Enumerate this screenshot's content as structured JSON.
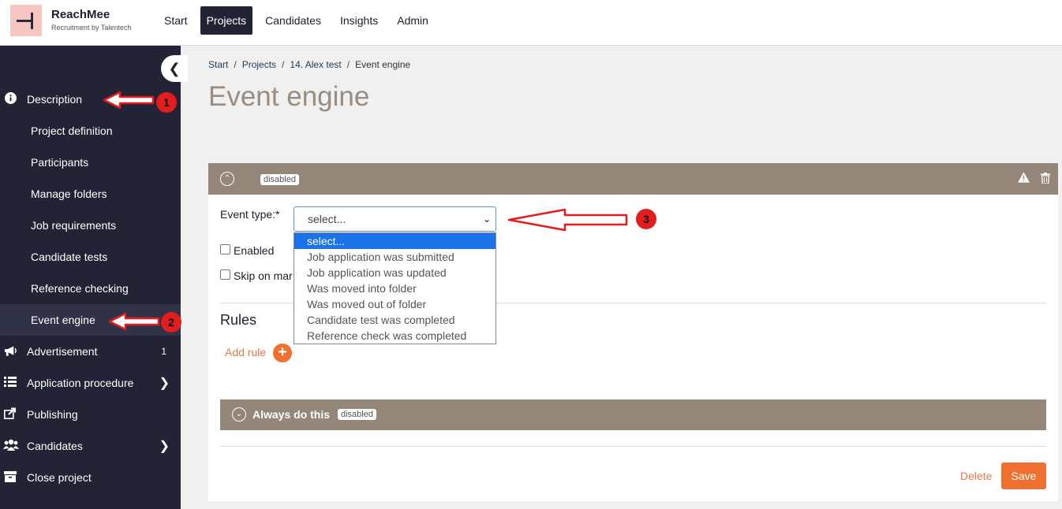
{
  "app": {
    "brand": "ReachMee",
    "tagline": "Recruitment by Talentech"
  },
  "topnav": [
    {
      "label": "Start"
    },
    {
      "label": "Projects",
      "active": true
    },
    {
      "label": "Candidates"
    },
    {
      "label": "Insights"
    },
    {
      "label": "Admin"
    }
  ],
  "sidebar": {
    "collapse_icon": "chevron-left-icon",
    "description": {
      "label": "Description",
      "icon": "info-icon"
    },
    "sub_items": [
      {
        "label": "Project definition"
      },
      {
        "label": "Participants"
      },
      {
        "label": "Manage folders"
      },
      {
        "label": "Job requirements"
      },
      {
        "label": "Candidate tests"
      },
      {
        "label": "Reference checking"
      },
      {
        "label": "Event engine",
        "active": true
      }
    ],
    "advertisement": {
      "label": "Advertisement",
      "badge": "1",
      "icon": "megaphone-icon"
    },
    "application_procedure": {
      "label": "Application procedure",
      "icon": "list-icon"
    },
    "publishing": {
      "label": "Publishing",
      "icon": "share-icon"
    },
    "candidates": {
      "label": "Candidates",
      "icon": "users-icon"
    },
    "close_project": {
      "label": "Close project",
      "icon": "archive-icon"
    }
  },
  "breadcrumb": {
    "items": [
      "Start",
      "Projects",
      "14. Alex test",
      "Event engine"
    ],
    "separator": "/"
  },
  "page": {
    "title": "Event engine"
  },
  "event": {
    "status_badge": "disabled",
    "event_type_label": "Event type:*",
    "select_value": "select...",
    "options": [
      "select...",
      "Job application was submitted",
      "Job application was updated",
      "Was moved into folder",
      "Was moved out of folder",
      "Candidate test was completed",
      "Reference check was completed"
    ],
    "enabled_label": "Enabled",
    "skip_label": "Skip on mar",
    "rules_title": "Rules",
    "add_rule_label": "Add rule",
    "always_title": "Always do this",
    "always_badge": "disabled",
    "delete_label": "Delete",
    "save_label": "Save"
  },
  "annotations": {
    "one": "1",
    "two": "2",
    "three": "3"
  },
  "colors": {
    "sidebar_bg": "#222334",
    "header_bar": "#948679",
    "accent_orange": "#f07030",
    "annotation_red": "#e21d1d",
    "title_color": "#9a8c80"
  }
}
